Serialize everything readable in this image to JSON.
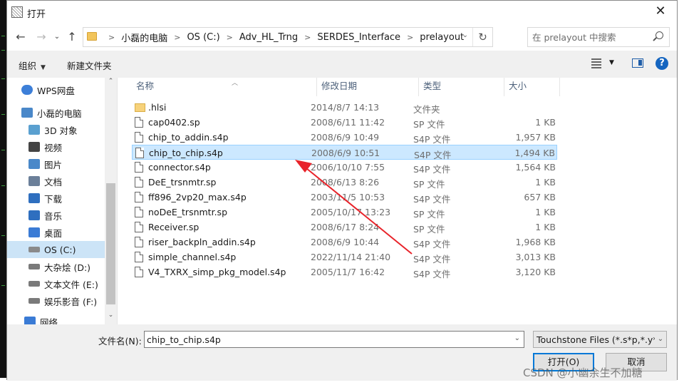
{
  "window": {
    "title": "打开",
    "close_glyph": "✕"
  },
  "address": {
    "crumbs": [
      "小磊的电脑",
      "OS (C:)",
      "Adv_HL_Trng",
      "SERDES_Interface",
      "prelayout"
    ],
    "search_placeholder": "在 prelayout 中搜索"
  },
  "toolbar": {
    "organize_label": "组织",
    "new_folder_label": "新建文件夹"
  },
  "nav": {
    "items": [
      {
        "label": "WPS网盘",
        "icon": "cloud-icon"
      },
      {
        "label": "小磊的电脑",
        "icon": "computer-icon"
      },
      {
        "label": "3D 对象",
        "icon": "cube-icon"
      },
      {
        "label": "视频",
        "icon": "video-icon"
      },
      {
        "label": "图片",
        "icon": "picture-icon"
      },
      {
        "label": "文档",
        "icon": "document-icon"
      },
      {
        "label": "下载",
        "icon": "download-icon"
      },
      {
        "label": "音乐",
        "icon": "music-icon"
      },
      {
        "label": "桌面",
        "icon": "desktop-icon"
      },
      {
        "label": "OS (C:)",
        "icon": "os-drive-icon",
        "selected": true
      },
      {
        "label": "大杂烩 (D:)",
        "icon": "drive-icon"
      },
      {
        "label": "文本文件 (E:)",
        "icon": "drive-icon"
      },
      {
        "label": "娱乐影音 (F:)",
        "icon": "drive-icon"
      },
      {
        "label": "网络",
        "icon": "network-icon"
      }
    ]
  },
  "columns": {
    "name": "名称",
    "date": "修改日期",
    "type": "类型",
    "size": "大小"
  },
  "files": [
    {
      "name": ".hlsi",
      "date": "2014/8/7 14:13",
      "type": "文件夹",
      "size": "",
      "folder": true
    },
    {
      "name": "cap0402.sp",
      "date": "2008/6/11 11:42",
      "type": "SP 文件",
      "size": "1 KB"
    },
    {
      "name": "chip_to_addin.s4p",
      "date": "2008/6/9 10:49",
      "type": "S4P 文件",
      "size": "1,957 KB"
    },
    {
      "name": "chip_to_chip.s4p",
      "date": "2008/6/9 10:51",
      "type": "S4P 文件",
      "size": "1,494 KB",
      "selected": true
    },
    {
      "name": "connector.s4p",
      "date": "2006/10/10 7:55",
      "type": "S4P 文件",
      "size": "1,564 KB"
    },
    {
      "name": "DeE_trsnmtr.sp",
      "date": "2008/6/13 8:26",
      "type": "SP 文件",
      "size": "1 KB"
    },
    {
      "name": "ff896_2vp20_max.s4p",
      "date": "2003/11/5 10:53",
      "type": "S4P 文件",
      "size": "657 KB"
    },
    {
      "name": "noDeE_trsnmtr.sp",
      "date": "2005/10/17 13:23",
      "type": "SP 文件",
      "size": "1 KB"
    },
    {
      "name": "Receiver.sp",
      "date": "2008/6/17 8:24",
      "type": "SP 文件",
      "size": "1 KB"
    },
    {
      "name": "riser_backpln_addin.s4p",
      "date": "2008/6/9 10:44",
      "type": "S4P 文件",
      "size": "1,968 KB"
    },
    {
      "name": "simple_channel.s4p",
      "date": "2022/11/14 21:40",
      "type": "S4P 文件",
      "size": "3,013 KB"
    },
    {
      "name": "V4_TXRX_simp_pkg_model.s4p",
      "date": "2005/11/7 16:42",
      "type": "S4P 文件",
      "size": "3,120 KB"
    }
  ],
  "bottom": {
    "filename_label": "文件名(N):",
    "filename_value": "chip_to_chip.s4p",
    "filter_label": "Touchstone Files (*.s*p,*.y*p,",
    "open_label": "打开(O)",
    "cancel_label": "取消"
  },
  "watermark": "CSDN @小幽余生不加糖",
  "colors": {
    "selection": "#cce8ff",
    "annotation_arrow": "#e8232a",
    "accent": "#0078d7"
  }
}
